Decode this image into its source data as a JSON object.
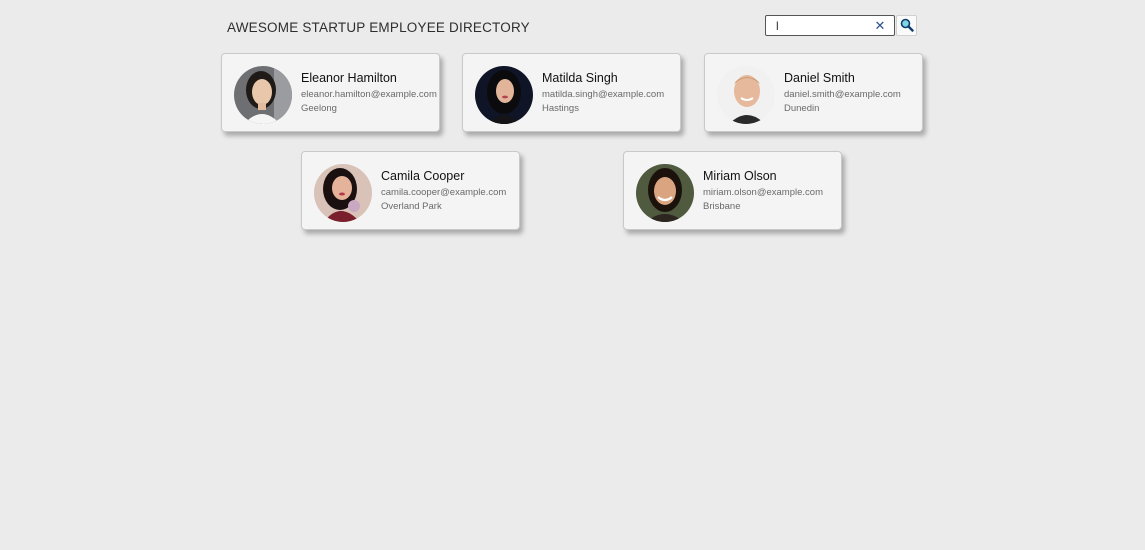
{
  "header": {
    "title": "AWESOME STARTUP EMPLOYEE DIRECTORY"
  },
  "search": {
    "value": "l",
    "placeholder": "",
    "clear_icon": "close-icon",
    "button_icon": "magnifier-icon"
  },
  "employees": [
    {
      "name": "Eleanor Hamilton",
      "email": "eleanor.hamilton@example.com",
      "city": "Geelong"
    },
    {
      "name": "Matilda Singh",
      "email": "matilda.singh@example.com",
      "city": "Hastings"
    },
    {
      "name": "Daniel Smith",
      "email": "daniel.smith@example.com",
      "city": "Dunedin"
    },
    {
      "name": "Camila Cooper",
      "email": "camila.cooper@example.com",
      "city": "Overland Park"
    },
    {
      "name": "Miriam Olson",
      "email": "miriam.olson@example.com",
      "city": "Brisbane"
    }
  ],
  "colors": {
    "background": "#ebebeb",
    "card": "#f4f4f4",
    "clear_icon": "#2d4f8f"
  }
}
